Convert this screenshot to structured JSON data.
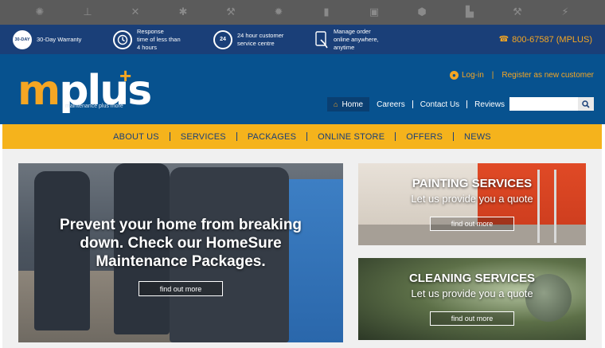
{
  "icon_strip": {
    "icons": [
      "ac-fan-icon",
      "faucet-icon",
      "tools-icon",
      "pest-icon",
      "wrench-icon",
      "bulb-icon",
      "drill-icon",
      "speaker-icon",
      "paint-roller-icon",
      "paint-bucket-icon",
      "hammer-icon",
      "lightning-icon"
    ],
    "glyphs": [
      "✺",
      "⊥",
      "✕",
      "✱",
      "⚒",
      "✹",
      "▮",
      "▣",
      "⬢",
      "▙",
      "⚒",
      "⚡"
    ]
  },
  "info_bar": {
    "warranty_badge": "30-DAY",
    "warranty": "30-Day Warranty",
    "response": "Response\ntime of less than\n4 hours",
    "service_badge": "24",
    "service": "24 hour customer\nservice centre",
    "online": "Manage order\nonline anywhere,\nanytime",
    "phone": "800-67587 (MPLUS)"
  },
  "header": {
    "logo_m": "m",
    "logo_rest": "plus",
    "logo_plus": "+",
    "tagline": "maintenance plus more",
    "login": "Log-in",
    "register": "Register as new customer",
    "nav": [
      "Home",
      "Careers",
      "Contact Us",
      "Reviews"
    ],
    "search_placeholder": ""
  },
  "main_nav": [
    "ABOUT US",
    "SERVICES",
    "PACKAGES",
    "ONLINE STORE",
    "OFFERS",
    "NEWS"
  ],
  "hero": {
    "headline": "Prevent your home from breaking down. Check our HomeSure Maintenance Packages.",
    "cta": "find out more"
  },
  "promos": [
    {
      "title": "PAINTING SERVICES",
      "subtitle": "Let us provide you a quote",
      "cta": "find out more"
    },
    {
      "title": "CLEANING SERVICES",
      "subtitle": "Let us provide you a quote",
      "cta": "find out more"
    }
  ],
  "colors": {
    "brand_blue": "#07528f",
    "accent_yellow": "#f5b31c",
    "dark_blue": "#1a3f78"
  }
}
